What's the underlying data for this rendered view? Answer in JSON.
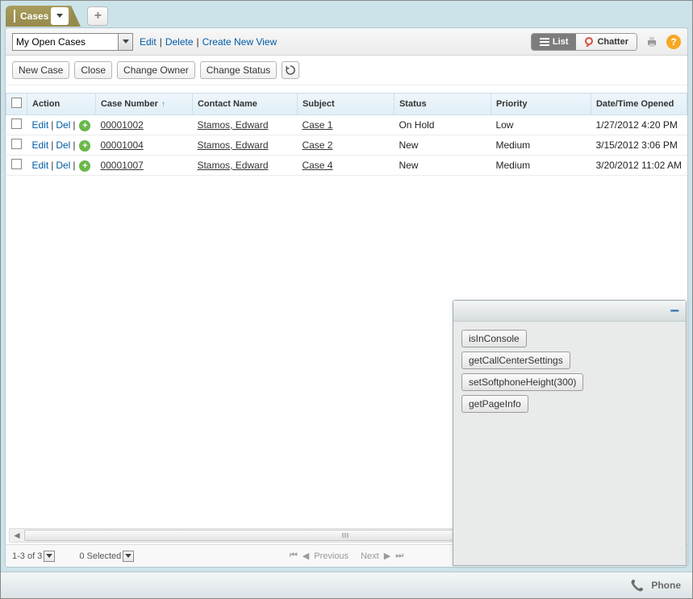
{
  "tabs": {
    "primary_label": "Cases"
  },
  "view": {
    "selected": "My Open Cases",
    "links": {
      "edit": "Edit",
      "delete": "Delete",
      "create": "Create New View"
    }
  },
  "toggle": {
    "list": "List",
    "chatter": "Chatter"
  },
  "buttons": {
    "new_case": "New Case",
    "close": "Close",
    "change_owner": "Change Owner",
    "change_status": "Change Status"
  },
  "columns": {
    "action": "Action",
    "case_number": "Case Number",
    "contact_name": "Contact Name",
    "subject": "Subject",
    "status": "Status",
    "priority": "Priority",
    "datetime": "Date/Time Opened"
  },
  "row_actions": {
    "edit": "Edit",
    "del": "Del"
  },
  "rows": [
    {
      "case_number": "00001002",
      "contact_name": "Stamos, Edward",
      "subject": "Case 1",
      "status": "On Hold",
      "priority": "Low",
      "datetime": "1/27/2012 4:20 PM"
    },
    {
      "case_number": "00001004",
      "contact_name": "Stamos, Edward",
      "subject": "Case 2",
      "status": "New",
      "priority": "Medium",
      "datetime": "3/15/2012 3:06 PM"
    },
    {
      "case_number": "00001007",
      "contact_name": "Stamos, Edward",
      "subject": "Case 4",
      "status": "New",
      "priority": "Medium",
      "datetime": "3/20/2012 11:02 AM"
    }
  ],
  "pager": {
    "range": "1-3 of 3",
    "selected": "0 Selected",
    "prev": "Previous",
    "next": "Next"
  },
  "softphone": {
    "buttons": [
      "isInConsole",
      "getCallCenterSettings",
      "setSoftphoneHeight(300)",
      "getPageInfo"
    ]
  },
  "bottom": {
    "phone": "Phone"
  }
}
